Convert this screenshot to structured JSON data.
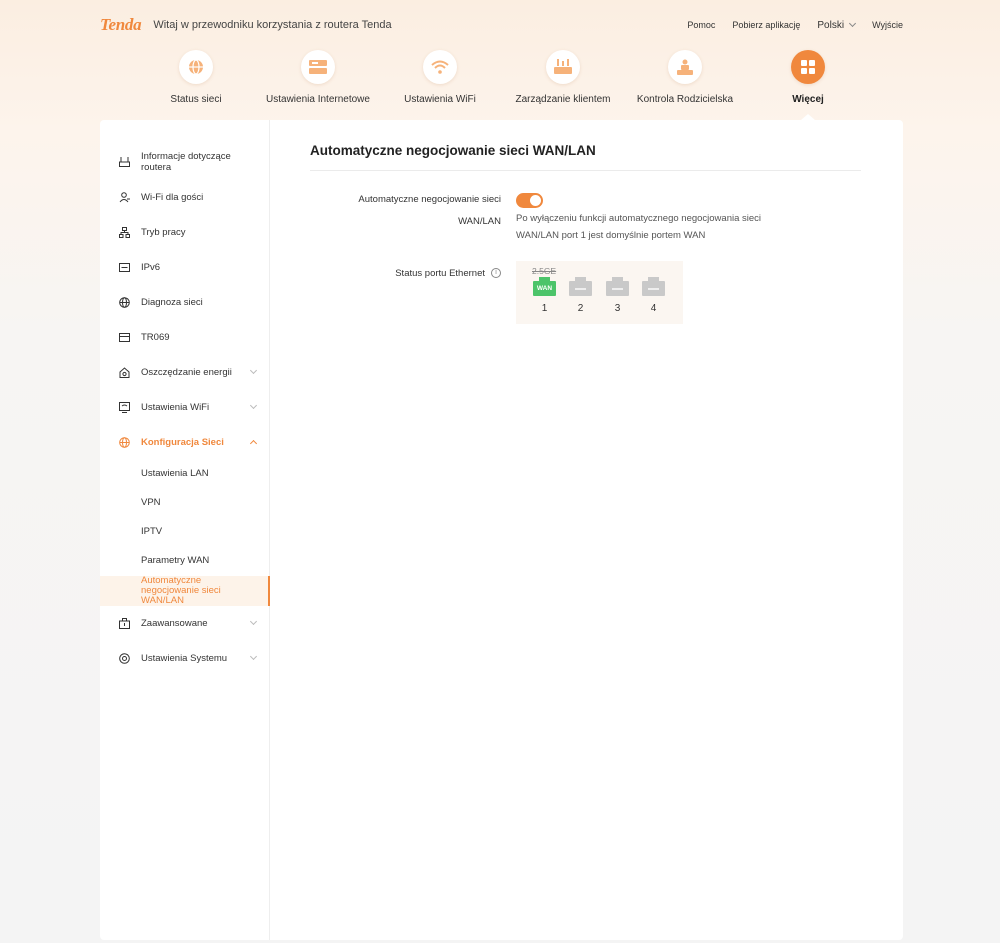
{
  "colors": {
    "accent": "#f0883d",
    "wan_green": "#4cc46a",
    "port_idle": "#c9c9c9"
  },
  "header": {
    "brand": "Tenda",
    "welcome": "Witaj w przewodniku korzystania z routera Tenda",
    "links": {
      "help": "Pomoc",
      "download_app": "Pobierz aplikację",
      "language": "Polski",
      "logout": "Wyjście"
    }
  },
  "nav": [
    {
      "label": "Status sieci",
      "icon": "globe-icon"
    },
    {
      "label": "Ustawienia Internetowe",
      "icon": "internet-icon"
    },
    {
      "label": "Ustawienia WiFi",
      "icon": "wifi-icon"
    },
    {
      "label": "Zarządzanie klientem",
      "icon": "router-icon"
    },
    {
      "label": "Kontrola Rodzicielska",
      "icon": "family-icon"
    },
    {
      "label": "Więcej",
      "icon": "grid-icon",
      "active": true
    }
  ],
  "sidebar": {
    "items": [
      {
        "label": "Informacje dotyczące routera",
        "icon": "router-info-icon"
      },
      {
        "label": "Wi-Fi dla gości",
        "icon": "guest-icon"
      },
      {
        "label": "Tryb pracy",
        "icon": "topology-icon"
      },
      {
        "label": "IPv6",
        "icon": "ipv6-icon"
      },
      {
        "label": "Diagnoza sieci",
        "icon": "globe-icon"
      },
      {
        "label": "TR069",
        "icon": "tr069-icon"
      },
      {
        "label": "Oszczędzanie energii",
        "icon": "leaf-house-icon"
      },
      {
        "label": "Ustawienia WiFi",
        "icon": "wifi-settings-icon"
      },
      {
        "label": "Konfiguracja Sieci",
        "icon": "globe-icon"
      },
      {
        "label": "Zaawansowane",
        "icon": "toolbox-icon"
      },
      {
        "label": "Ustawienia Systemu",
        "icon": "system-icon"
      }
    ],
    "subitems": [
      "Ustawienia LAN",
      "VPN",
      "IPTV",
      "Parametry WAN",
      "Automatyczne negocjowanie sieci WAN/LAN"
    ]
  },
  "main": {
    "title": "Automatyczne negocjowanie sieci WAN/LAN",
    "auto_label_line1": "Automatyczne negocjowanie sieci",
    "auto_label_line2": "WAN/LAN",
    "toggle_on": true,
    "description": "Po wyłączeniu funkcji automatycznego negocjowania sieci WAN/LAN port 1 jest domyślnie portem WAN",
    "eth_label": "Status portu Ethernet",
    "info_glyph": "i",
    "speed": "2.5GE",
    "ports": [
      {
        "num": "1",
        "tag": "WAN",
        "state": "wan"
      },
      {
        "num": "2",
        "tag": "",
        "state": "idle"
      },
      {
        "num": "3",
        "tag": "",
        "state": "idle"
      },
      {
        "num": "4",
        "tag": "",
        "state": "idle"
      }
    ]
  }
}
